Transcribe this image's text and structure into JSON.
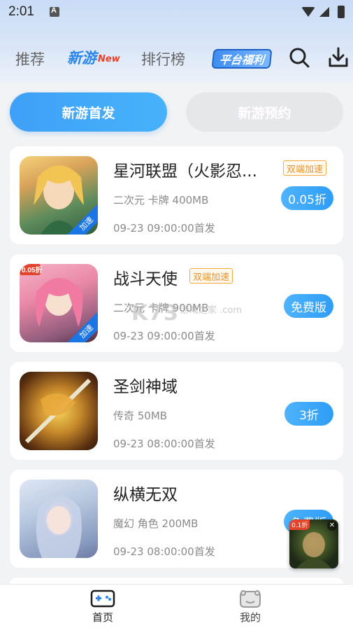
{
  "status_bar": {
    "time": "2:01"
  },
  "top_nav": {
    "tabs": [
      {
        "label": "推荐"
      },
      {
        "label": "新游",
        "badge": "New"
      },
      {
        "label": "排行榜"
      }
    ],
    "welfare_label": "平台福利",
    "active_tab": "新游",
    "active_color": "#2a86ea"
  },
  "segments": {
    "primary": "新游首发",
    "secondary": "新游预约"
  },
  "games": [
    {
      "title": "星河联盟（火影忍...",
      "tag": "双端加速",
      "thumb_badge": "加速",
      "meta": "二次元 卡牌 400MB",
      "date": "09-23 09:00:00首发",
      "price": "0.05折"
    },
    {
      "title": "战斗天使",
      "tag": "双端加速",
      "thumb_badge": "加速",
      "meta": "二次元 卡牌 900MB",
      "date": "09-23 09:00:00首发",
      "price": "免费版"
    },
    {
      "title": "圣剑神域",
      "meta": "传奇 50MB",
      "date": "09-23 08:00:00首发",
      "price": "3折"
    },
    {
      "title": "纵横无双",
      "meta": "魔幻 角色 200MB",
      "date": "09-23 08:00:00首发",
      "price": "免费版"
    }
  ],
  "watermark": {
    "logo": "K73",
    "sub": "游戏之家 .com"
  },
  "float_ad": {
    "tag": "0.1折"
  },
  "bottom_nav": {
    "home": "首页",
    "mine": "我的"
  },
  "colors": {
    "accent": "#3ea0f7",
    "tag_orange": "#e9932a"
  }
}
